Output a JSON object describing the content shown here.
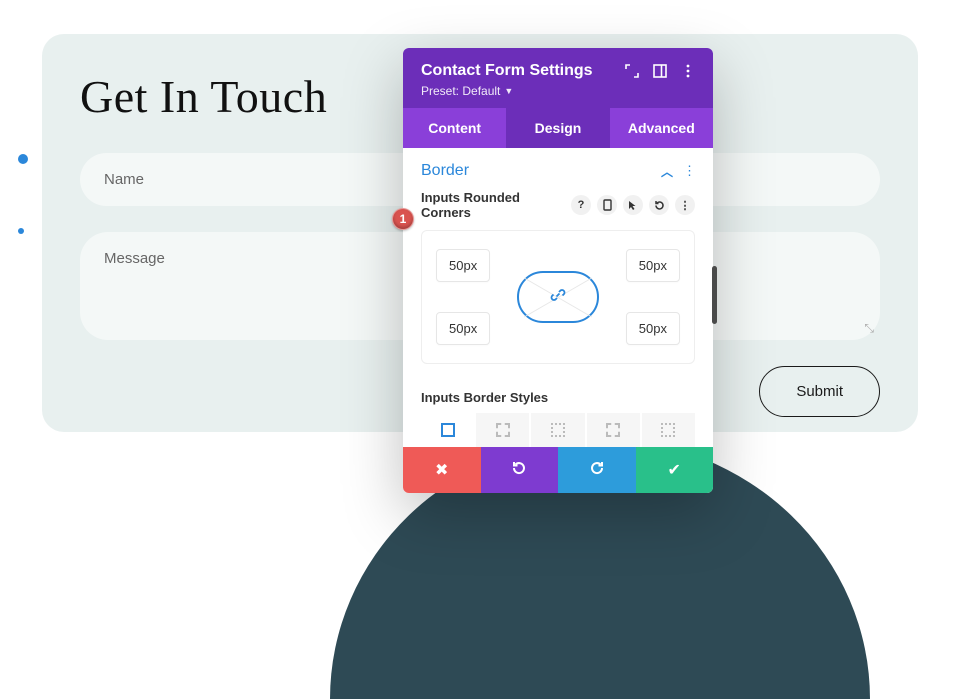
{
  "page": {
    "title": "Get In Touch",
    "name_placeholder": "Name",
    "message_placeholder": "Message",
    "submit_label": "Submit"
  },
  "modal": {
    "title": "Contact Form Settings",
    "preset_label": "Preset: Default",
    "tabs": {
      "content": "Content",
      "design": "Design",
      "advanced": "Advanced",
      "active": "design"
    },
    "section": {
      "title": "Border"
    },
    "rounded": {
      "label": "Inputs Rounded Corners",
      "tl": "50px",
      "tr": "50px",
      "bl": "50px",
      "br": "50px"
    },
    "border_styles_label": "Inputs Border Styles"
  },
  "annotation": {
    "number": "1"
  }
}
